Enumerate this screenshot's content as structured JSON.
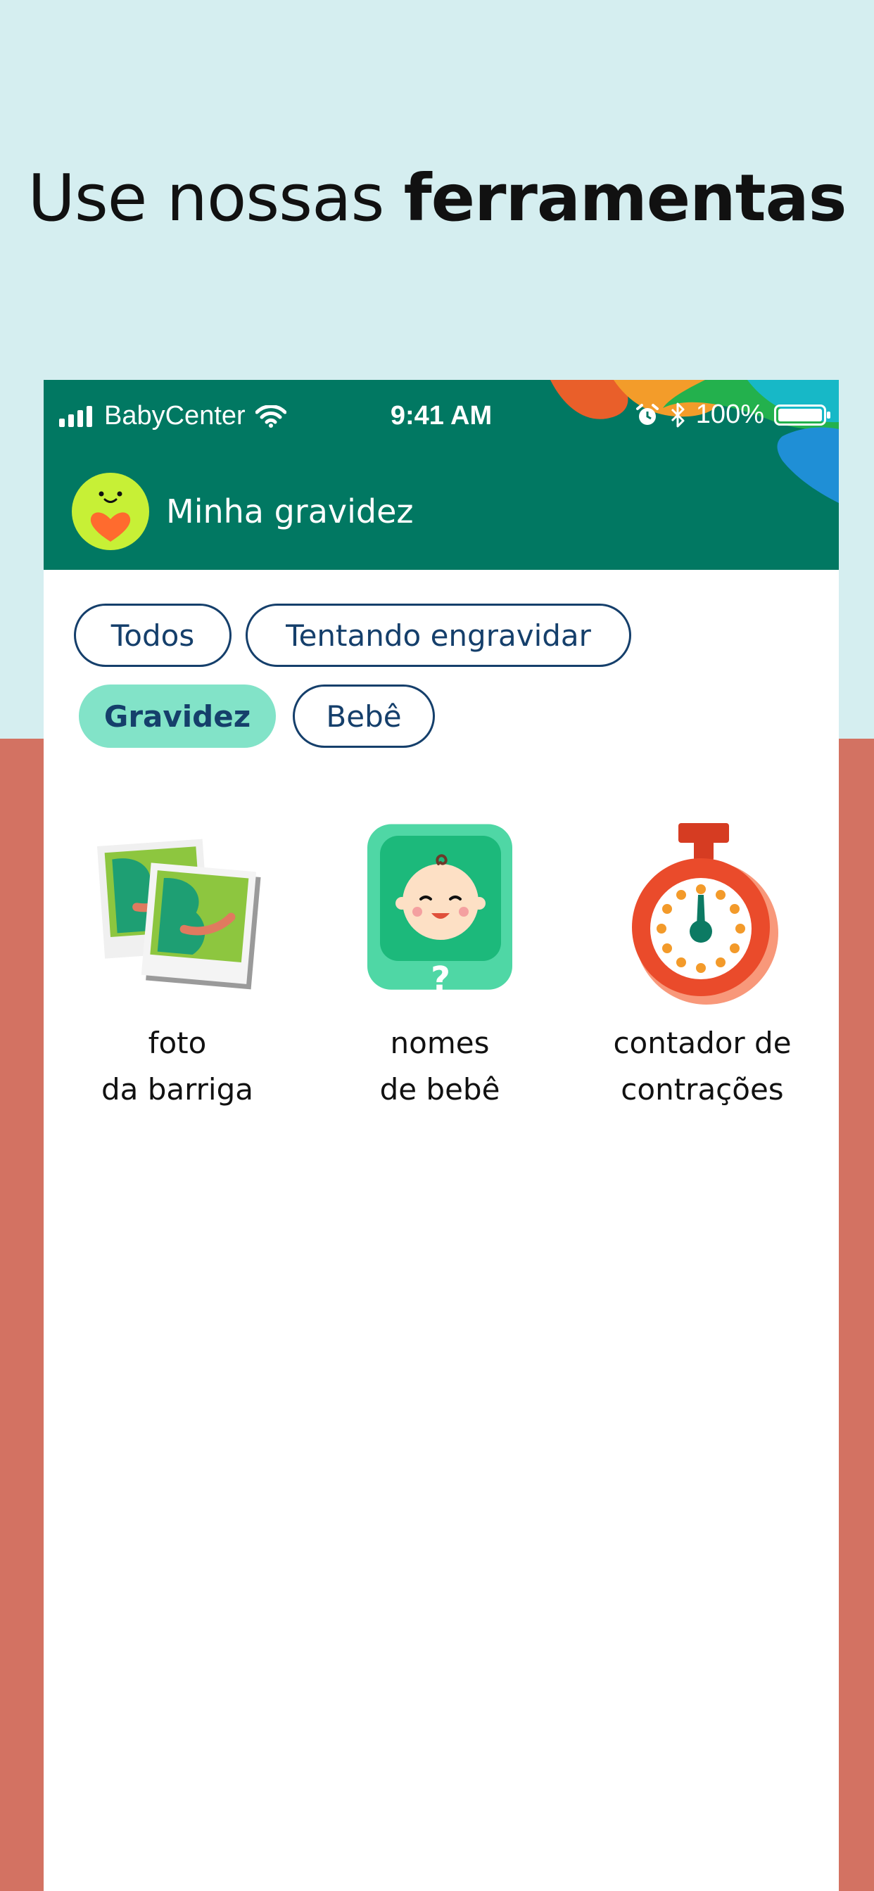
{
  "hero": {
    "headline_regular": "Use nossas ",
    "headline_bold": "ferramentas"
  },
  "status_bar": {
    "carrier": "BabyCenter",
    "time": "9:41 AM",
    "battery": "100%"
  },
  "header": {
    "profile_label": "Minha gravidez"
  },
  "filters": [
    {
      "label": "Todos",
      "selected": false
    },
    {
      "label": "Tentando engravidar",
      "selected": false
    },
    {
      "label": "Gravidez",
      "selected": true
    },
    {
      "label": "Bebê",
      "selected": false
    }
  ],
  "tools": [
    {
      "icon": "bump-photo-icon",
      "line1": "foto",
      "line2": "da barriga"
    },
    {
      "icon": "baby-names-icon",
      "line1": "nomes",
      "line2": "de bebê"
    },
    {
      "icon": "contraction-timer-icon",
      "line1": "contador de",
      "line2": "contrações"
    }
  ],
  "colors": {
    "top_background": "#d5eef0",
    "bottom_background": "#d37262",
    "header_green": "#017862",
    "chip_border": "#153f6b",
    "chip_active": "#82e3c8"
  }
}
